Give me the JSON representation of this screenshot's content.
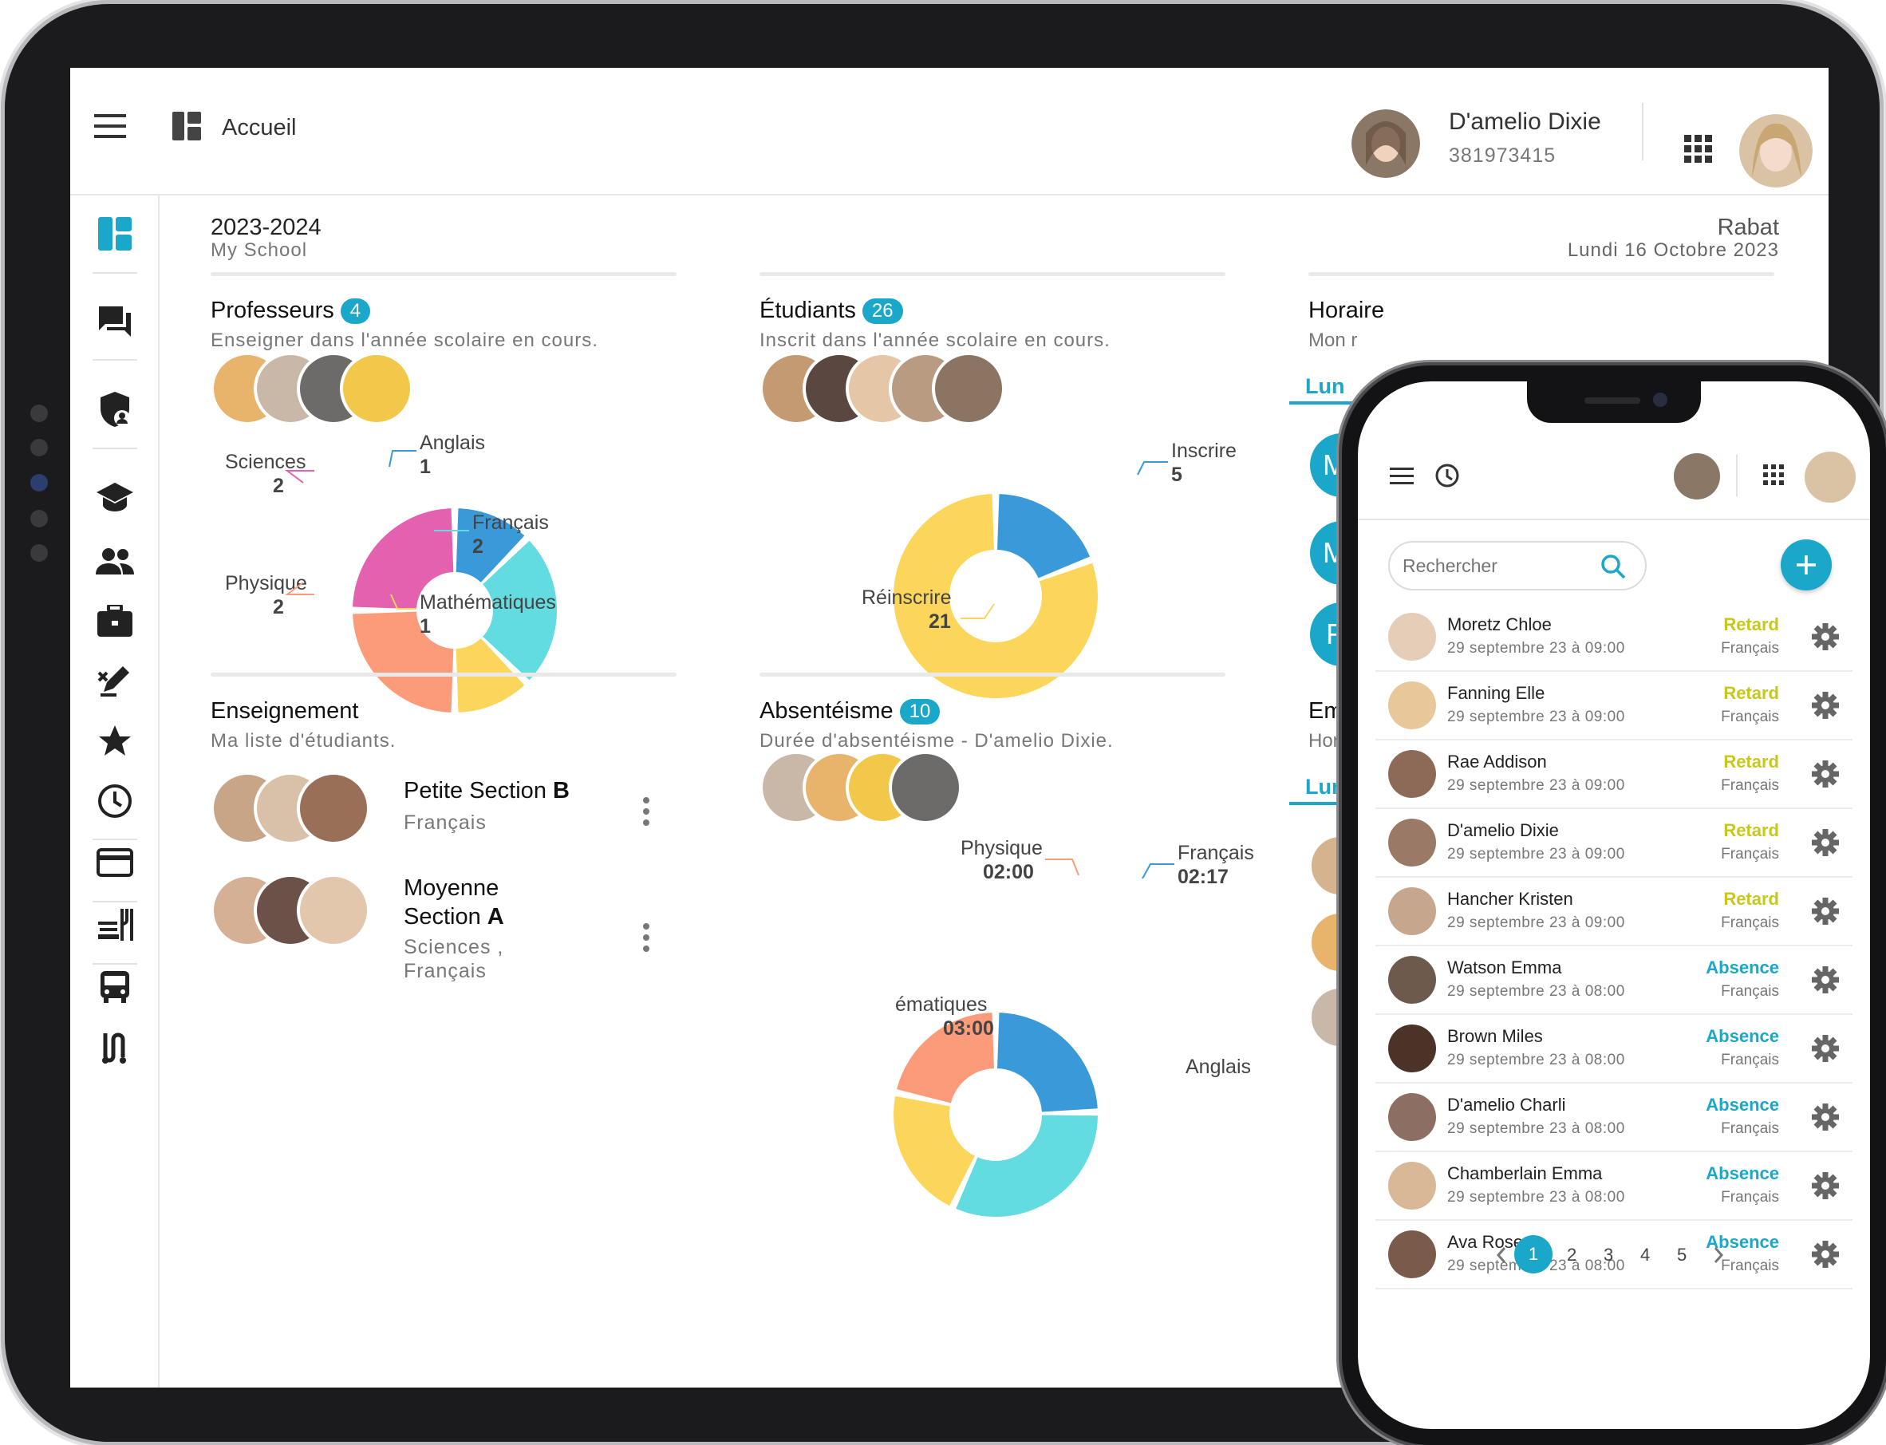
{
  "app": {
    "title": "Accueil"
  },
  "user": {
    "name": "D'amelio Dixie",
    "id": "381973415"
  },
  "school": {
    "year": "2023-2024",
    "name": "My School",
    "city": "Rabat",
    "date": "Lundi 16 Octobre 2023"
  },
  "teachers": {
    "title": "Professeurs",
    "count": "4",
    "subtitle": "Enseigner dans l'année scolaire en cours."
  },
  "students": {
    "title": "Étudiants",
    "count": "26",
    "subtitle": "Inscrit dans l'année scolaire en cours."
  },
  "schedule": {
    "title": "Horaire",
    "subtitle": "Mon r",
    "tab": "Lun",
    "letters": [
      "M",
      "M",
      "F"
    ]
  },
  "teaching": {
    "title": "Enseignement",
    "subtitle": "Ma liste d'étudiants.",
    "classes": [
      {
        "name_main": "Petite Section",
        "name_bold": "B",
        "subjects": [
          "Français"
        ]
      },
      {
        "name_main": "Moyenne Section",
        "name_bold": "A",
        "subjects": [
          "Sciences ,",
          "Français"
        ]
      }
    ]
  },
  "absence": {
    "title": "Absentéisme",
    "count": "10",
    "subtitle": "Durée d'absentéisme - D'amelio Dixie."
  },
  "emp": {
    "title": "Emp",
    "subtitle": "Hora",
    "tab": "Lun"
  },
  "chart_data": [
    {
      "type": "pie",
      "title": "Professeurs",
      "series": [
        {
          "values": [
            {
              "label": "Anglais",
              "value": 1,
              "color": "#3a9ad9"
            },
            {
              "label": "Français",
              "value": 2,
              "color": "#62dce0"
            },
            {
              "label": "Mathématiques",
              "value": 1,
              "color": "#fcd65a"
            },
            {
              "label": "Physique",
              "value": 2,
              "color": "#fc9b7a"
            },
            {
              "label": "Sciences",
              "value": 2,
              "color": "#e361ae"
            }
          ]
        }
      ]
    },
    {
      "type": "pie",
      "title": "Étudiants",
      "series": [
        {
          "values": [
            {
              "label": "Inscrire",
              "value": 5,
              "color": "#3a9ad9"
            },
            {
              "label": "Réinscrire",
              "value": 21,
              "color": "#fcd65a"
            }
          ]
        }
      ]
    },
    {
      "type": "pie",
      "title": "Absentéisme",
      "labels": [
        {
          "label": "Français",
          "value": "02:17"
        },
        {
          "label": "Physique",
          "value": "02:00"
        },
        {
          "label": "ématiques",
          "value": "03:00"
        },
        {
          "label": "Anglais",
          "value": ""
        }
      ],
      "colors": [
        "#3a9ad9",
        "#62dce0",
        "#fcd65a",
        "#fc9b7a"
      ]
    }
  ],
  "phone": {
    "search_placeholder": "Rechercher",
    "rows": [
      {
        "name": "Moretz Chloe",
        "date": "29 septembre 23 à 09:00",
        "status": "Retard",
        "subject": "Français"
      },
      {
        "name": "Fanning Elle",
        "date": "29 septembre 23 à 09:00",
        "status": "Retard",
        "subject": "Français"
      },
      {
        "name": "Rae Addison",
        "date": "29 septembre 23 à 09:00",
        "status": "Retard",
        "subject": "Français"
      },
      {
        "name": "D'amelio Dixie",
        "date": "29 septembre 23 à 09:00",
        "status": "Retard",
        "subject": "Français"
      },
      {
        "name": "Hancher Kristen",
        "date": "29 septembre 23 à 09:00",
        "status": "Retard",
        "subject": "Français"
      },
      {
        "name": "Watson Emma",
        "date": "29 septembre 23 à 08:00",
        "status": "Absence",
        "subject": "Français"
      },
      {
        "name": "Brown Miles",
        "date": "29 septembre 23 à 08:00",
        "status": "Absence",
        "subject": "Français"
      },
      {
        "name": "D'amelio Charli",
        "date": "29 septembre 23 à 08:00",
        "status": "Absence",
        "subject": "Français"
      },
      {
        "name": "Chamberlain Emma",
        "date": "29 septembre 23 à 08:00",
        "status": "Absence",
        "subject": "Français"
      },
      {
        "name": "Ava Rose",
        "date": "29 septembre 23 à 08:00",
        "status": "Absence",
        "subject": "Français"
      }
    ],
    "pages": [
      "1",
      "2",
      "3",
      "4",
      "5"
    ],
    "current_page": "1"
  },
  "colors": {
    "accent": "#1aa7c9",
    "retard": "#c8c81c",
    "absence": "#1aa7c9"
  }
}
